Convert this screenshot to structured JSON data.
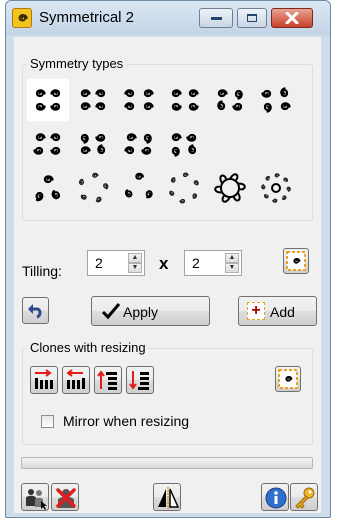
{
  "window": {
    "title": "Symmetrical 2",
    "icon": "spiral-knot-icon",
    "controls": [
      "minimize-icon",
      "maximize-icon",
      "close-icon"
    ]
  },
  "symmetry": {
    "label": "Symmetry types",
    "selected": "row1-1",
    "rows": [
      [
        "mirror-left-right",
        "mirror-both",
        "mirror-quad",
        "mirror-vertical",
        "rotate-2",
        "rotate-4"
      ],
      [
        "mirror-pair-a",
        "mirror-pair-b",
        "mirror-pair-c",
        "mirror-pair-d"
      ],
      [
        "rotate-3",
        "rotate-4-star",
        "rotate-3-trefoil",
        "rotate-6",
        "rotate-6-ring",
        "rotate-8"
      ]
    ]
  },
  "tilling": {
    "label": "Tilling:",
    "x_value": "2",
    "times": "x",
    "y_value": "2",
    "options_icon": "spiral-options-icon"
  },
  "actions": {
    "undo_icon": "undo-arrow-icon",
    "apply_label": "Apply",
    "apply_icon": "check-icon",
    "add_label": "Add",
    "add_icon": "plus-box-icon"
  },
  "clones": {
    "label": "Clones with resizing",
    "buttons": [
      "resize-bars-right-icon",
      "resize-bars-left-icon",
      "resize-lines-up-icon",
      "resize-lines-down-icon"
    ],
    "options_icon": "spiral-options-icon",
    "mirror_label": "Mirror when resizing",
    "mirror_checked": false
  },
  "progress": {
    "value": 0
  },
  "bottom": {
    "icons": [
      "people-select-icon",
      "delete-red-x-icon",
      "mirror-triangles-icon",
      "info-icon",
      "key-icon"
    ]
  },
  "colors": {
    "accent_orange": "#f0a020",
    "selection_bg": "#ffffff",
    "close_red": "#c7412a"
  }
}
